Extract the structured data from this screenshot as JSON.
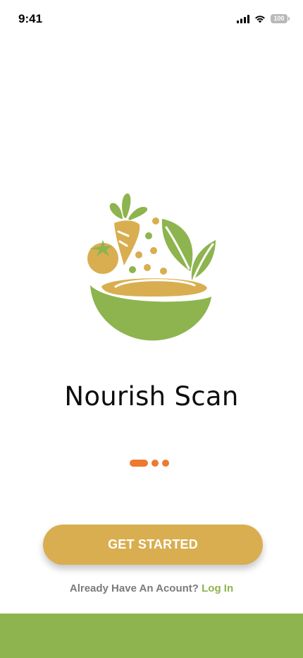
{
  "status_bar": {
    "time": "9:41",
    "battery": "100"
  },
  "logo": {
    "icon": "salad-bowl-logo",
    "colors": {
      "green": "#8db44e",
      "gold": "#d9ae50",
      "orange": "#ed7a2e"
    }
  },
  "app": {
    "title": "Nourish Scan"
  },
  "pager": {
    "page_count": 3,
    "active_page": 1
  },
  "actions": {
    "get_started_label": "GET STARTED",
    "login_prompt": "Already Have An Acount?",
    "login_link": "Log In"
  },
  "colors": {
    "accent_green": "#8db44e",
    "button_gold": "#d9ae50",
    "dot_orange": "#ed7a2e"
  }
}
